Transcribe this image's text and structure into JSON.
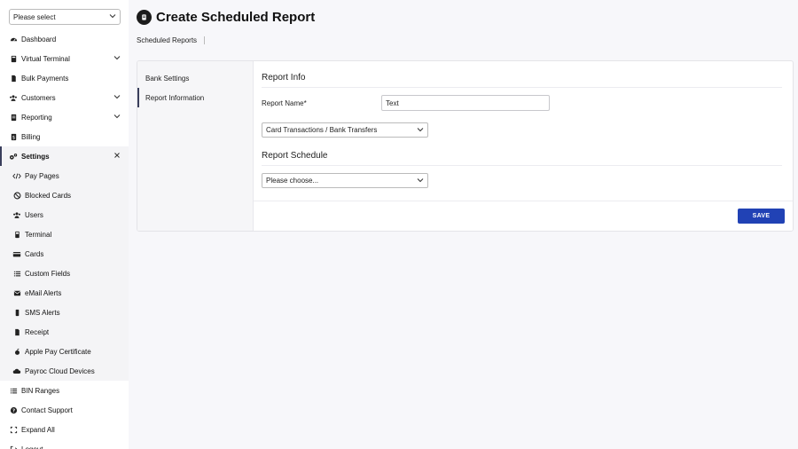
{
  "org_select": {
    "value": "Please select"
  },
  "nav": [
    {
      "label": "Dashboard",
      "icon": "dashboard-icon",
      "right": ""
    },
    {
      "label": "Virtual Terminal",
      "icon": "calculator-icon",
      "right": "chevron"
    },
    {
      "label": "Bulk Payments",
      "icon": "document-icon",
      "right": ""
    },
    {
      "label": "Customers",
      "icon": "users-icon",
      "right": "chevron"
    },
    {
      "label": "Reporting",
      "icon": "report-icon",
      "right": "chevron"
    },
    {
      "label": "Billing",
      "icon": "billing-icon",
      "right": ""
    },
    {
      "label": "Settings",
      "icon": "gears-icon",
      "right": "close"
    },
    {
      "label": "Pay Pages",
      "icon": "code-icon",
      "right": "",
      "sub": true
    },
    {
      "label": "Blocked Cards",
      "icon": "ban-icon",
      "right": "",
      "sub": true
    },
    {
      "label": "Users",
      "icon": "users-icon",
      "right": "",
      "sub": true
    },
    {
      "label": "Terminal",
      "icon": "terminal-icon",
      "right": "",
      "sub": true
    },
    {
      "label": "Cards",
      "icon": "card-icon",
      "right": "",
      "sub": true
    },
    {
      "label": "Custom Fields",
      "icon": "list-icon",
      "right": "",
      "sub": true
    },
    {
      "label": "eMail Alerts",
      "icon": "envelope-icon",
      "right": "",
      "sub": true
    },
    {
      "label": "SMS Alerts",
      "icon": "phone-icon",
      "right": "",
      "sub": true
    },
    {
      "label": "Receipt",
      "icon": "receipt-icon",
      "right": "",
      "sub": true
    },
    {
      "label": "Apple Pay Certificate",
      "icon": "apple-icon",
      "right": "",
      "sub": true
    },
    {
      "label": "Payroc Cloud Devices",
      "icon": "cloud-icon",
      "right": "",
      "sub": true
    },
    {
      "label": "BIN Ranges",
      "icon": "list-icon",
      "right": ""
    },
    {
      "label": "Contact Support",
      "icon": "question-icon",
      "right": ""
    },
    {
      "label": "Expand All",
      "icon": "expand-icon",
      "right": ""
    },
    {
      "label": "Logout",
      "icon": "logout-icon",
      "right": ""
    }
  ],
  "header": {
    "title": "Create Scheduled Report",
    "breadcrumb": "Scheduled Reports"
  },
  "tabs": [
    {
      "label": "Bank Settings"
    },
    {
      "label": "Report Information"
    }
  ],
  "report_info": {
    "title": "Report Info",
    "name_label": "Report Name*",
    "name_value": "Text",
    "type_select": "Card Transactions / Bank Transfers"
  },
  "report_schedule": {
    "title": "Report Schedule",
    "schedule_select": "Please choose..."
  },
  "actions": {
    "save": "SAVE"
  },
  "colors": {
    "accent": "#2142b5",
    "sidebar_active": "#3a3f5c"
  }
}
